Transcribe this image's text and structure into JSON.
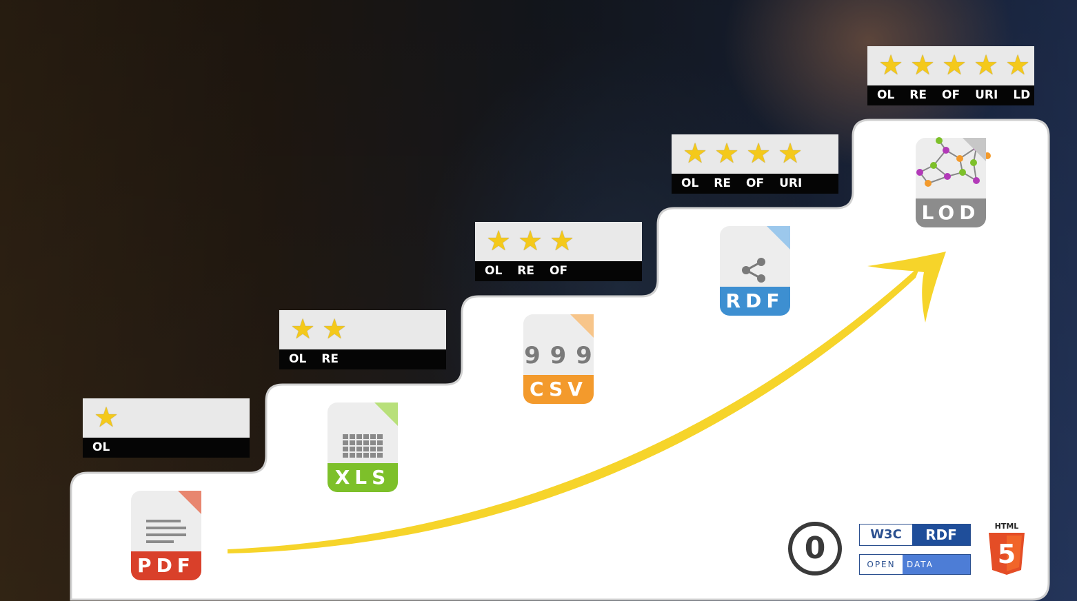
{
  "badges": [
    {
      "stars": 1,
      "labels": [
        "OL"
      ]
    },
    {
      "stars": 2,
      "labels": [
        "OL",
        "RE"
      ]
    },
    {
      "stars": 3,
      "labels": [
        "OL",
        "RE",
        "OF"
      ]
    },
    {
      "stars": 4,
      "labels": [
        "OL",
        "RE",
        "OF",
        "URI"
      ]
    },
    {
      "stars": 5,
      "labels": [
        "OL",
        "RE",
        "OF",
        "URI",
        "LD"
      ]
    }
  ],
  "file_icons": [
    {
      "label": "PDF",
      "color": "#d9402a",
      "fold_color": "#e8866f",
      "icon": "document-lines-icon"
    },
    {
      "label": "XLS",
      "color": "#7dc02a",
      "fold_color": "#b8e07a",
      "icon": "spreadsheet-grid-icon"
    },
    {
      "label": "CSV",
      "color": "#f39a2c",
      "fold_color": "#f7c58a",
      "icon": "quote-marks-icon"
    },
    {
      "label": "RDF",
      "color": "#3d8fd1",
      "fold_color": "#9cc8ec",
      "icon": "share-graph-icon"
    },
    {
      "label": "LOD",
      "color": "#8c8c8c",
      "fold_color": "#c7c7c7",
      "icon": "network-graph-icon"
    }
  ],
  "csv_glyph": "9 9 9",
  "logos": {
    "cc0": "0",
    "w3c_left": "W3C",
    "w3c_right": "RDF",
    "open_data_left": "OPEN",
    "open_data_right": "DATA",
    "html5_label": "HTML",
    "html5_number": "5"
  },
  "colors": {
    "star": "#f4c91b",
    "arrow": "#f6d42a",
    "panel": "#ffffff",
    "badge_top": "#e9e9e9",
    "badge_bottom": "#050505"
  }
}
